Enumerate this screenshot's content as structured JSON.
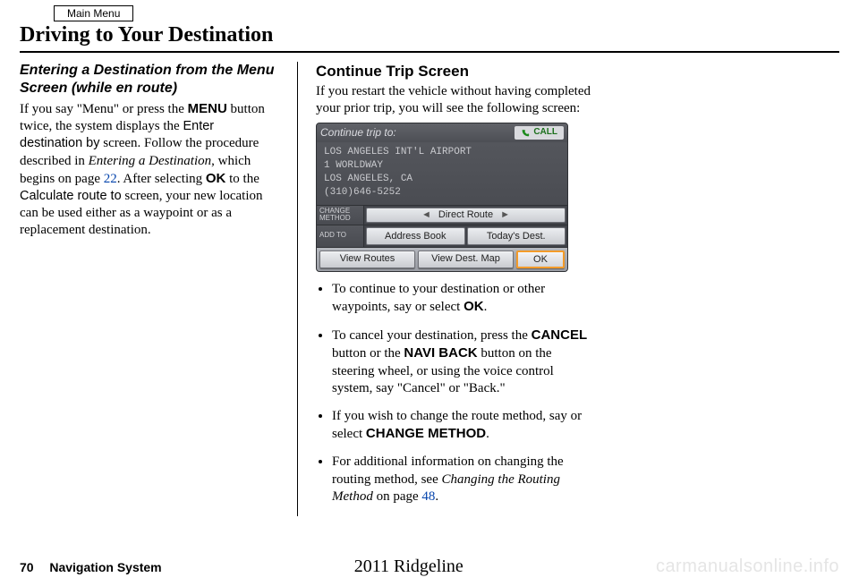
{
  "main_menu_label": "Main Menu",
  "page_title": "Driving to Your Destination",
  "col1": {
    "heading": "Entering a Destination from the Menu Screen (while en route)",
    "p_part1": "If you say \"Menu\" or press the ",
    "p_menu": "MENU",
    "p_part2": " button twice, the system displays the ",
    "p_enter": "Enter destination by",
    "p_part3": " screen. Follow the procedure described in ",
    "p_entering": "Entering a Destination",
    "p_part4": ", which begins on page ",
    "p_pg1": "22",
    "p_part5": ". After selecting ",
    "p_ok": "OK",
    "p_part6": " to the ",
    "p_calc": "Calculate route to",
    "p_part7": " screen, your new location can be used either as a waypoint or as a replacement destination."
  },
  "col2": {
    "heading": "Continue Trip Screen",
    "intro": "If you restart the vehicle without having completed your prior trip, you will see the following screen:",
    "screen": {
      "top": "Continue trip to:",
      "call": "CALL",
      "addr1": "LOS ANGELES INT'L AIRPORT",
      "addr2": "1 WORLDWAY",
      "addr3": "LOS ANGELES, CA",
      "addr4": "(310)646-5252",
      "change_method": "CHANGE METHOD",
      "direct_route": "Direct Route",
      "add_to": "ADD TO",
      "addr_book": "Address Book",
      "todays": "Today's Dest.",
      "view_routes": "View Routes",
      "view_dest": "View Dest. Map",
      "ok": "OK"
    },
    "b1_a": "To continue to your destination or other waypoints, say or select ",
    "b1_b": "OK",
    "b1_c": ".",
    "b2_a": "To cancel your destination, press the ",
    "b2_b": "CANCEL",
    "b2_c": " button or the ",
    "b2_d": "NAVI BACK",
    "b2_e": " button on the steering wheel, or using the voice control system, say \"Cancel\" or \"Back.\"",
    "b3_a": "If you wish to change the route method, say or select ",
    "b3_b": "CHANGE METHOD",
    "b3_c": ".",
    "b4_a": "For additional information on changing the routing method, see ",
    "b4_b": "Changing the Routing Method",
    "b4_c": " on page ",
    "b4_pg": "48",
    "b4_d": "."
  },
  "footer": {
    "page_no": "70",
    "system": "Navigation System",
    "vehicle": "2011 Ridgeline",
    "watermark": "carmanualsonline.info"
  }
}
